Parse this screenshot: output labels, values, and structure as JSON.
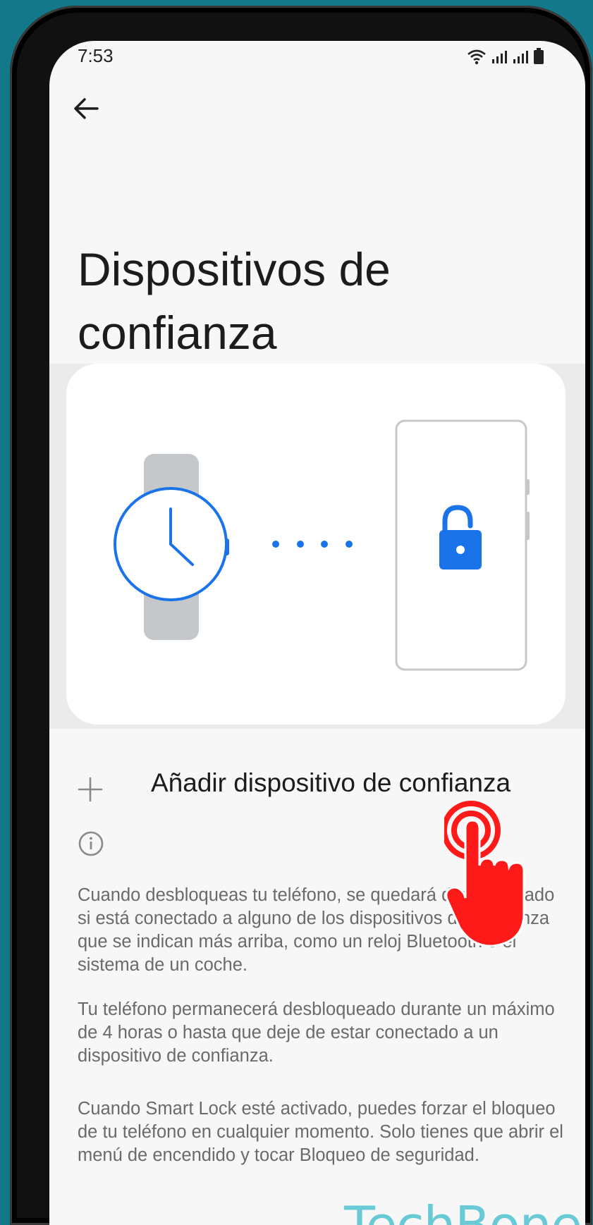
{
  "status_bar": {
    "time": "7:53"
  },
  "page": {
    "title": "Dispositivos de confianza",
    "add_trusted_device_label": "Añadir dispositivo de confianza"
  },
  "info": {
    "paragraphs": [
      "Cuando desbloqueas tu teléfono, se quedará desbloqueado si está conectado a alguno de los dispositivos de confianza que se indican más arriba, como un reloj Bluetooth o el sistema de un coche.",
      "Tu teléfono permanecerá desbloqueado durante un máximo de 4 horas o hasta que deje de estar conectado a un dispositivo de confianza.",
      "Cuando Smart Lock esté activado, puedes forzar el bloqueo de tu teléfono en cualquier momento. Solo tienes que abrir el menú de encendido y tocar Bloqueo de seguridad."
    ]
  },
  "watermark": "TechBone",
  "colors": {
    "accent": "#1a73e8",
    "background": "#13788a",
    "tap_indicator": "#ff1a1a"
  },
  "icons": [
    "back-arrow-icon",
    "wifi-icon",
    "signal-icon",
    "battery-icon",
    "plus-icon",
    "info-icon",
    "watch-icon",
    "padlock-icon",
    "tap-hand-icon"
  ]
}
